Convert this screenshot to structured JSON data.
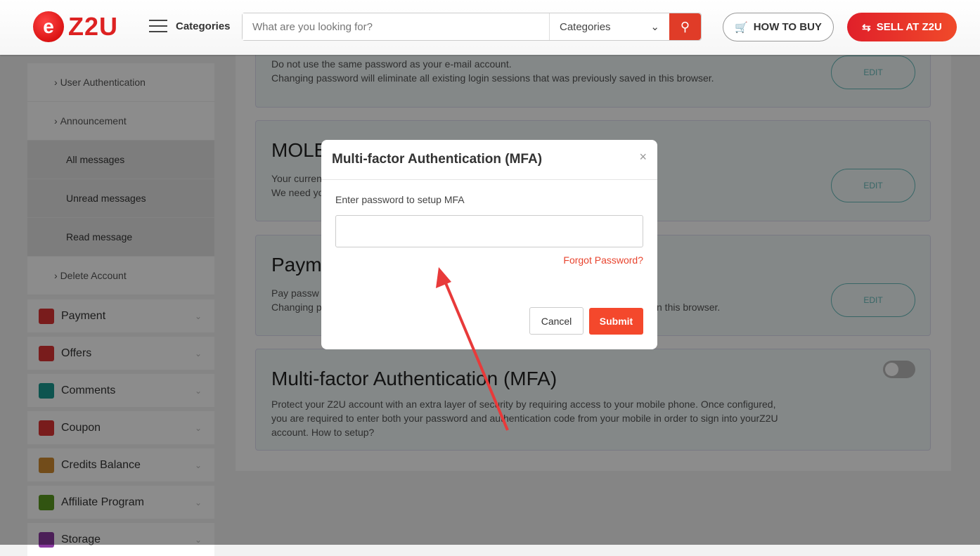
{
  "header": {
    "logo": "Z2U",
    "categories_label": "Categories",
    "search_placeholder": "What are you looking for?",
    "search_category": "Categories",
    "how_to_buy": "HOW TO BUY",
    "sell": "SELL AT Z2U"
  },
  "sidebar": {
    "subitems": [
      {
        "label": "User Authentication"
      },
      {
        "label": "Announcement"
      }
    ],
    "messages": [
      {
        "label": "All messages"
      },
      {
        "label": "Unread messages"
      },
      {
        "label": "Read message"
      }
    ],
    "delete": "Delete Account",
    "menus": [
      {
        "label": "Payment",
        "color": "#d33"
      },
      {
        "label": "Offers",
        "color": "#d33"
      },
      {
        "label": "Comments",
        "color": "#1a9a90"
      },
      {
        "label": "Coupon",
        "color": "#d33"
      },
      {
        "label": "Credits Balance",
        "color": "#d08a30"
      },
      {
        "label": "Affiliate Program",
        "color": "#5a9a20"
      },
      {
        "label": "Storage",
        "color": "#8a3aa0"
      }
    ]
  },
  "cards": {
    "password": {
      "line1": "Do not use the same password as your e-mail account.",
      "line2": "Changing password will eliminate all existing login sessions that was previously saved in this browser.",
      "edit": "EDIT"
    },
    "mole": {
      "title": "MOLE",
      "line1": "Your curren",
      "line2": "We need yo",
      "edit": "EDIT"
    },
    "payment": {
      "title": "Paym",
      "line1": "Pay passw",
      "line2": "Changing p",
      "line2_tail": "n this browser.",
      "edit": "EDIT"
    },
    "mfa": {
      "title": "Multi-factor Authentication (MFA)",
      "desc": "Protect your Z2U account with an extra layer of security by requiring access to your mobile phone. Once configured, you are required to enter both your password and authentication code from your mobile in order to sign into yourZ2U account. How to setup?",
      "enabled": false
    }
  },
  "modal": {
    "title": "Multi-factor Authentication (MFA)",
    "close": "×",
    "label": "Enter password to setup MFA",
    "input_value": "",
    "forgot": "Forgot Password?",
    "cancel": "Cancel",
    "submit": "Submit"
  },
  "colors": {
    "accent": "#e03c28",
    "teal": "#66bbbb",
    "annotation_arrow": "#e83a3a"
  }
}
